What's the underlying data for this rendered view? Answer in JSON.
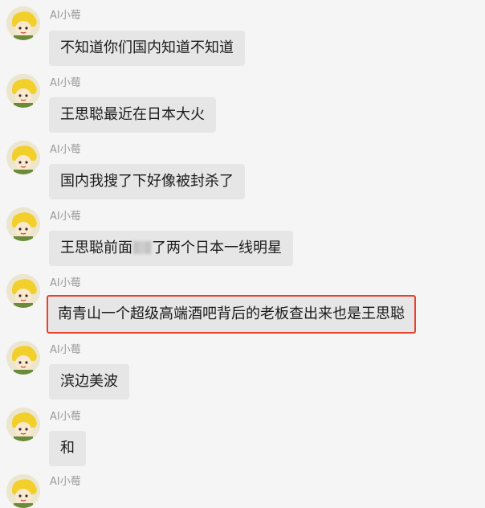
{
  "sender_name": "AI小莓",
  "messages": [
    {
      "text": "不知道你们国内知道不知道"
    },
    {
      "text": "王思聪最近在日本大火"
    },
    {
      "text": "国内我搜了下好像被封杀了"
    },
    {
      "text_before": "王思聪前面",
      "text_after": "了两个日本一线明星",
      "redacted": true
    },
    {
      "text": "南青山一个超级高端酒吧背后的老板查出来也是王思聪",
      "highlighted": true,
      "highlight_color": "#e8412d"
    },
    {
      "text": "滨边美波"
    },
    {
      "text": "和"
    },
    {
      "text": ""
    }
  ],
  "avatar_icon": "cartoon-avatar-icon",
  "colors": {
    "background": "#f5f5f5",
    "bubble": "#e6e6e6",
    "highlight_border": "#e8412d",
    "sender_text": "#9a9a9a"
  }
}
